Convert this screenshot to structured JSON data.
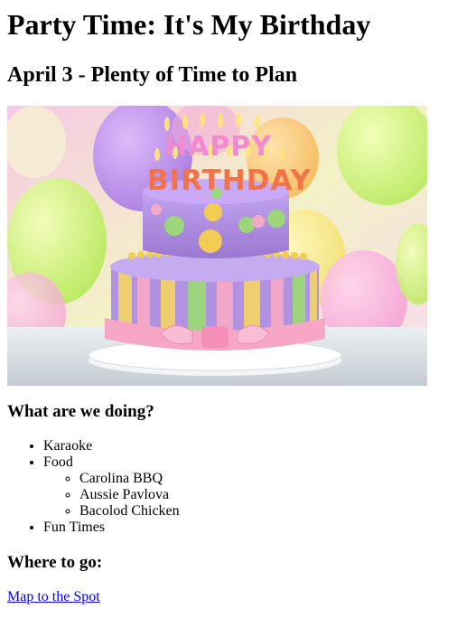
{
  "page": {
    "title": "Party Time: It's My Birthday",
    "subtitle": "April 3 - Plenty of Time to Plan"
  },
  "image": {
    "cake_text_top": "HAPPY",
    "cake_text_bottom": "BIRTHDAY",
    "colors": {
      "cake_purple": "#a98ad6",
      "stripe_yellow": "#f3d26a",
      "stripe_pink": "#f5a9c8",
      "ribbon_pink": "#f7a7c5",
      "dot_green": "#9dd67a",
      "dot_yellow": "#f2cd53"
    }
  },
  "activities": {
    "heading": "What are we doing?",
    "items": {
      "karaoke": "Karaoke",
      "food": "Food",
      "fun": "Fun Times"
    },
    "food_items": [
      "Carolina BBQ",
      "Aussie Pavlova",
      "Bacolod Chicken"
    ]
  },
  "location": {
    "heading": "Where to go:",
    "link_text": "Map to the Spot"
  }
}
